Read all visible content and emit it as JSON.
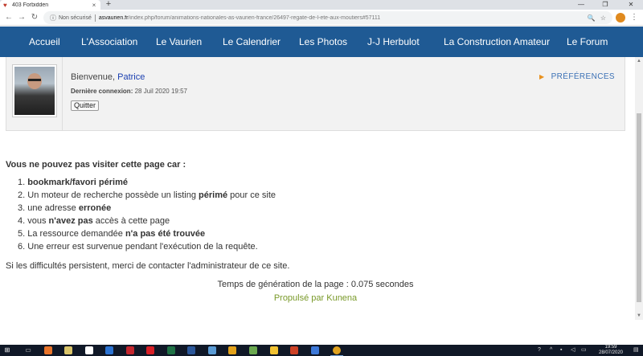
{
  "browser": {
    "tab_title": "403 Forbidden",
    "tab_close": "×",
    "new_tab": "+",
    "minimize": "—",
    "maximize": "❐",
    "close_window": "✕",
    "back": "←",
    "forward": "→",
    "reload": "↻",
    "info_icon": "ⓘ",
    "security_label": "Non sécurisé",
    "url_domain": "asvaurien.fr",
    "url_path": "/index.php/forum/animations-nationales-as-vaurien-france/26497-regate-de-l-ete-aux-moutiers#57111",
    "zoom_icon": "🔍",
    "star_icon": "☆",
    "menu_icon": "⋮"
  },
  "nav": {
    "items": [
      "Accueil",
      "L'Association",
      "Le Vaurien",
      "Le Calendrier",
      "Les Photos",
      "J-J Herbulot",
      "La Construction Amateur",
      "Le Forum"
    ]
  },
  "profile": {
    "welcome_text": "Bienvenue,",
    "username": "Patrice",
    "last_login_label": "Dernière connexion:",
    "last_login_value": "28 Juil 2020 19:57",
    "quit_button": "Quitter",
    "preferences": "PRÉFÉRENCES",
    "preferences_arrow": "▶"
  },
  "error": {
    "title": "Vous ne pouvez pas visiter cette page car :",
    "items": [
      {
        "num": "1.",
        "pre": "",
        "bold": "bookmark/favori périmé",
        "post": ""
      },
      {
        "num": "2.",
        "pre": "Un moteur de recherche possède un listing ",
        "bold": "périmé",
        "post": " pour ce site"
      },
      {
        "num": "3.",
        "pre": "une adresse ",
        "bold": "erronée",
        "post": ""
      },
      {
        "num": "4.",
        "pre": "vous ",
        "bold": "n'avez pas",
        "post": " accès à cette page"
      },
      {
        "num": "5.",
        "pre": "La ressource demandée ",
        "bold": "n'a pas été trouvée",
        "post": ""
      },
      {
        "num": "6.",
        "pre": "Une erreur est survenue pendant l'exécution de la requête.",
        "bold": "",
        "post": ""
      }
    ],
    "contact": "Si les difficultés persistent, merci de contacter l'administrateur de ce site."
  },
  "footer": {
    "generation_time": "Temps de génération de la page : 0.075 secondes",
    "powered_by": "Propulsé par Kunena"
  },
  "taskbar": {
    "time": "19:59",
    "date": "28/07/2020"
  },
  "colors": {
    "nav_bg": "#1f5a94",
    "kunena_link": "#7a9a2a",
    "username_link": "#1a3fb0",
    "preferences_link": "#3a70b5"
  }
}
